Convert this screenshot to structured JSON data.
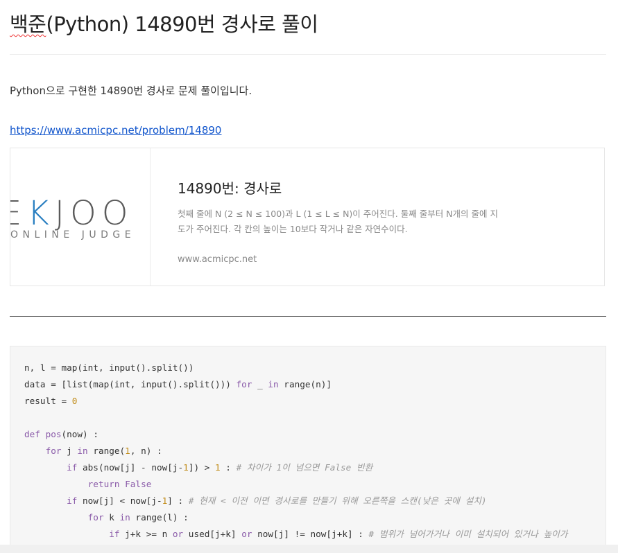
{
  "post": {
    "title_prefix": "백준",
    "title_rest": "(Python) 14890번 경사로 풀이",
    "intro": "Python으로 구현한 14890번 경사로 문제 풀이입니다.",
    "link": "https://www.acmicpc.net/problem/14890"
  },
  "card": {
    "logo_left": "E",
    "logo_k": "K",
    "logo_right": "JOO",
    "logo_sub": "ONLINE JUDGE",
    "title": "14890번: 경사로",
    "description": "첫째 줄에 N (2 ≤ N ≤ 100)과 L (1 ≤ L ≤ N)이 주어진다. 둘째 줄부터 N개의 줄에 지도가 주어진다. 각 칸의 높이는 10보다 작거나 같은 자연수이다.",
    "domain": "www.acmicpc.net"
  },
  "code": {
    "l1": "n, l = map(int, input().split())",
    "l2a": "data = [list(map(int, input().split())) ",
    "l2_for": "for",
    "l2b": " _ ",
    "l2_in": "in",
    "l2c": " range(n)]",
    "l3a": "result = ",
    "l3_num": "0",
    "l5_def": "def",
    "l5_sp": " ",
    "l5_name": "pos",
    "l5_rest": "(now) :",
    "l6_for": "for",
    "l6_j": " j ",
    "l6_in": "in",
    "l6a": " range(",
    "l6_num": "1",
    "l6b": ", n) :",
    "l7_if": "if",
    "l7a": " abs(now[j] - now[j-",
    "l7_n1": "1",
    "l7b": "]) > ",
    "l7_n2": "1",
    "l7c": " : ",
    "l7_cm": "# 차이가 1이 넘으면 False 반환",
    "l8_ret": "return",
    "l8_sp": " ",
    "l8_false": "False",
    "l9_if": "if",
    "l9a": " now[j] < now[j-",
    "l9_n1": "1",
    "l9b": "] : ",
    "l9_cm": "# 현재 < 이전 이면 경사로를 만들기 위해 오른쪽을 스캔(낮은 곳에 설치)",
    "l10_for": "for",
    "l10_k": " k ",
    "l10_in": "in",
    "l10a": " range(l) :",
    "l11_if": "if",
    "l11a": " j+k >= n ",
    "l11_or1": "or",
    "l11b": " used[j+k] ",
    "l11_or2": "or",
    "l11c": " now[j] != now[j+k] : ",
    "l11_cm": "# 범위가 넘어가거나 이미 설치되어 있거나 높이가"
  },
  "colors": {
    "keyword": "#8959a8",
    "number": "#c08a16",
    "comment": "#999999",
    "link": "#1155cc",
    "logo_accent": "#2a7fc1"
  }
}
